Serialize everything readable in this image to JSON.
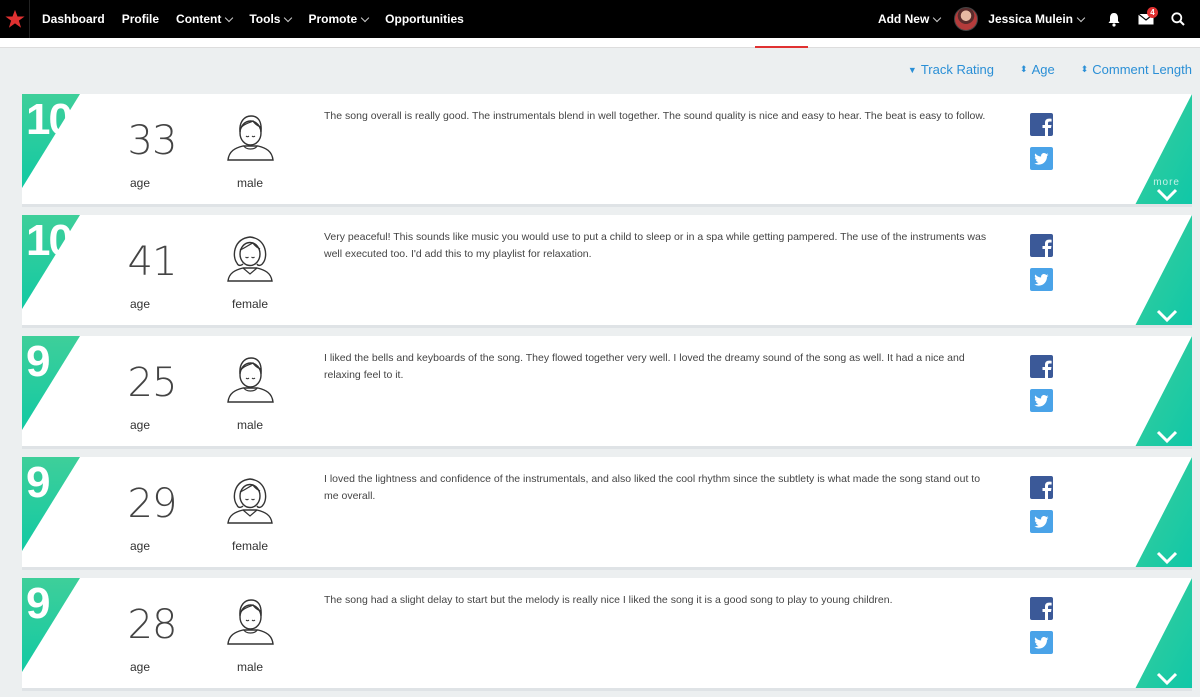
{
  "nav": {
    "items": [
      {
        "label": "Dashboard",
        "dropdown": false
      },
      {
        "label": "Profile",
        "dropdown": false
      },
      {
        "label": "Content",
        "dropdown": true
      },
      {
        "label": "Tools",
        "dropdown": true
      },
      {
        "label": "Promote",
        "dropdown": true
      },
      {
        "label": "Opportunities",
        "dropdown": false
      }
    ],
    "add_new": "Add New",
    "user_name": "Jessica Mulein",
    "message_count": "4",
    "icons": [
      "star-logo-icon",
      "bell-icon",
      "envelope-icon",
      "search-icon"
    ]
  },
  "sort": {
    "track_rating": "Track Rating",
    "age": "Age",
    "comment_length": "Comment Length"
  },
  "labels": {
    "age": "age",
    "more": "more"
  },
  "reviews": [
    {
      "rating": "10",
      "age": "33",
      "gender": "male",
      "comment": "The song overall is really good. The instrumentals blend in well together. The sound quality is nice and easy to hear. The beat is easy to follow."
    },
    {
      "rating": "10",
      "age": "41",
      "gender": "female",
      "comment": "Very peaceful! This sounds like music you would use to put a child to sleep or in a spa while getting pampered. The use of the instruments was well executed too. I'd add this to my playlist for relaxation."
    },
    {
      "rating": "9",
      "age": "25",
      "gender": "male",
      "comment": "I liked the bells and keyboards of the song. They flowed together very well. I loved the dreamy sound of the song as well. It had a nice and relaxing feel to it."
    },
    {
      "rating": "9",
      "age": "29",
      "gender": "female",
      "comment": "I loved the lightness and confidence of the instrumentals, and also liked the cool rhythm since the subtlety is what made the song stand out to me overall."
    },
    {
      "rating": "9",
      "age": "28",
      "gender": "male",
      "comment": "The song had a slight delay to start but the melody is really nice I liked the song it is a good song to play to young children."
    }
  ],
  "colors": {
    "accent_green_top": "#3ecf9a",
    "accent_green_bottom": "#12c9a3",
    "nav_bg": "#000000",
    "link_blue": "#2a8fd6",
    "facebook": "#3b5998",
    "twitter": "#4aa3e8",
    "active_red": "#e03131"
  }
}
